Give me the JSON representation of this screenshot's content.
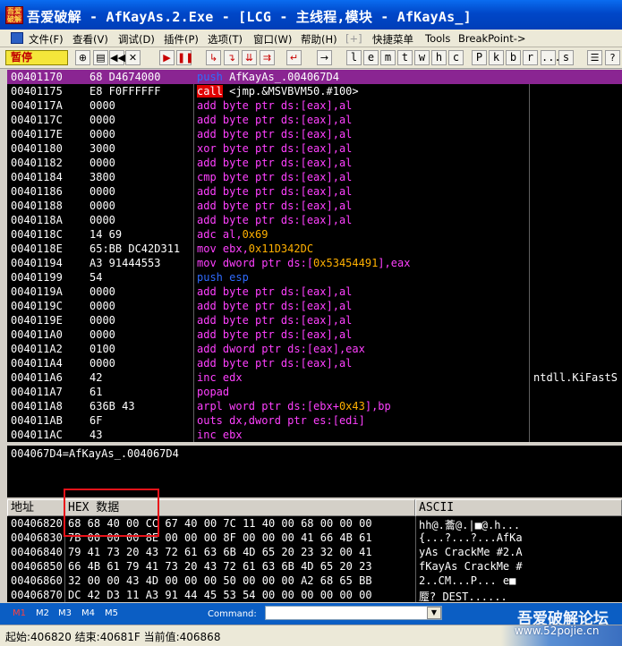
{
  "titlebar": {
    "icon_text": "吾爱\n破解",
    "title": "吾爱破解 - AfKayAs.2.Exe - [LCG - 主线程,模块 - AfKayAs_]"
  },
  "menubar": {
    "items": [
      "文件(F)",
      "查看(V)",
      "调试(D)",
      "插件(P)",
      "选项(T)",
      "窗口(W)",
      "帮助(H)",
      "[+]",
      "快捷菜单",
      "Tools",
      "BreakPoint->"
    ]
  },
  "toolbar": {
    "status": "暂停",
    "letter_buttons": [
      "l",
      "e",
      "m",
      "t",
      "w",
      "h",
      "c",
      "P",
      "k",
      "b",
      "r",
      "...",
      "s"
    ]
  },
  "disassembly": {
    "rows": [
      {
        "addr": "00401170",
        "hex": "68 D4674000",
        "ins": [
          [
            "push",
            "k-push"
          ],
          [
            " AfKayAs_.004067D4",
            "k-norm"
          ]
        ],
        "selected": true
      },
      {
        "addr": "00401175",
        "hex": "E8 F0FFFFFF",
        "ins": [
          [
            "call",
            "k-call"
          ],
          [
            " <jmp.&MSVBVM50.#100>",
            "k-norm"
          ]
        ]
      },
      {
        "addr": "0040117A",
        "hex": "0000",
        "ins": [
          [
            "add byte ptr ds:[eax],al",
            "k-op"
          ]
        ]
      },
      {
        "addr": "0040117C",
        "hex": "0000",
        "ins": [
          [
            "add byte ptr ds:[eax],al",
            "k-op"
          ]
        ]
      },
      {
        "addr": "0040117E",
        "hex": "0000",
        "ins": [
          [
            "add byte ptr ds:[eax],al",
            "k-op"
          ]
        ]
      },
      {
        "addr": "00401180",
        "hex": "3000",
        "ins": [
          [
            "xor byte ptr ds:[eax],al",
            "k-op"
          ]
        ]
      },
      {
        "addr": "00401182",
        "hex": "0000",
        "ins": [
          [
            "add byte ptr ds:[eax],al",
            "k-op"
          ]
        ]
      },
      {
        "addr": "00401184",
        "hex": "3800",
        "ins": [
          [
            "cmp byte ptr ds:[eax],al",
            "k-op"
          ]
        ]
      },
      {
        "addr": "00401186",
        "hex": "0000",
        "ins": [
          [
            "add byte ptr ds:[eax],al",
            "k-op"
          ]
        ]
      },
      {
        "addr": "00401188",
        "hex": "0000",
        "ins": [
          [
            "add byte ptr ds:[eax],al",
            "k-op"
          ]
        ]
      },
      {
        "addr": "0040118A",
        "hex": "0000",
        "ins": [
          [
            "add byte ptr ds:[eax],al",
            "k-op"
          ]
        ]
      },
      {
        "addr": "0040118C",
        "hex": "14 69",
        "ins": [
          [
            "adc al,",
            "k-op"
          ],
          [
            "0x69",
            "k-num"
          ]
        ]
      },
      {
        "addr": "0040118E",
        "hex": "65:BB DC42D311",
        "ins": [
          [
            "mov ebx,",
            "k-op"
          ],
          [
            "0x11D342DC",
            "k-num"
          ]
        ]
      },
      {
        "addr": "00401194",
        "hex": "A3 91444553",
        "ins": [
          [
            "mov dword ptr ds:[",
            "k-op"
          ],
          [
            "0x53454491",
            "k-num"
          ],
          [
            "],eax",
            "k-op"
          ]
        ]
      },
      {
        "addr": "00401199",
        "hex": "54",
        "ins": [
          [
            "push esp",
            "k-push"
          ]
        ]
      },
      {
        "addr": "0040119A",
        "hex": "0000",
        "ins": [
          [
            "add byte ptr ds:[eax],al",
            "k-op"
          ]
        ]
      },
      {
        "addr": "0040119C",
        "hex": "0000",
        "ins": [
          [
            "add byte ptr ds:[eax],al",
            "k-op"
          ]
        ]
      },
      {
        "addr": "0040119E",
        "hex": "0000",
        "ins": [
          [
            "add byte ptr ds:[eax],al",
            "k-op"
          ]
        ]
      },
      {
        "addr": "004011A0",
        "hex": "0000",
        "ins": [
          [
            "add byte ptr ds:[eax],al",
            "k-op"
          ]
        ]
      },
      {
        "addr": "004011A2",
        "hex": "0100",
        "ins": [
          [
            "add dword ptr ds:[eax],eax",
            "k-op"
          ]
        ]
      },
      {
        "addr": "004011A4",
        "hex": "0000",
        "ins": [
          [
            "add byte ptr ds:[eax],al",
            "k-op"
          ]
        ]
      },
      {
        "addr": "004011A6",
        "hex": "42",
        "ins": [
          [
            "inc edx",
            "k-op"
          ]
        ]
      },
      {
        "addr": "004011A7",
        "hex": "61",
        "ins": [
          [
            "popad",
            "k-op"
          ]
        ]
      },
      {
        "addr": "004011A8",
        "hex": "636B 43",
        "ins": [
          [
            "arpl word ptr ds:[ebx+",
            "k-op"
          ],
          [
            "0x43",
            "k-num"
          ],
          [
            "],bp",
            "k-op"
          ]
        ]
      },
      {
        "addr": "004011AB",
        "hex": "6F",
        "ins": [
          [
            "outs dx,dword ptr es:[edi]",
            "k-op"
          ]
        ]
      },
      {
        "addr": "004011AC",
        "hex": "43",
        "ins": [
          [
            "inc ebx",
            "k-op"
          ]
        ]
      }
    ],
    "comment": "ntdll.KiFastS"
  },
  "info": {
    "text": "004067D4=AfKayAs_.004067D4"
  },
  "dump": {
    "header_addr": "地址",
    "header_hex": "HEX 数据",
    "header_ascii": "ASCII",
    "rows": [
      {
        "addr": "00406820",
        "hex": "68 68 40 00 CC 67 40 00 7C 11 40 00 68 00 00 00",
        "ascii": "hh@.蘥@.|■@.h..."
      },
      {
        "addr": "00406830",
        "hex": "7B 00 00 00 8E 00 00 00 8F 00 00 00 41 66 4B 61",
        "ascii": "{...?...?...AfKa"
      },
      {
        "addr": "00406840",
        "hex": "79 41 73 20 43 72 61 63 6B 4D 65 20 23 32 00 41",
        "ascii": "yAs CrackMe #2.A"
      },
      {
        "addr": "00406850",
        "hex": "66 4B 61 79 41 73 20 43 72 61 63 6B 4D 65 20 23",
        "ascii": "fKayAs CrackMe #"
      },
      {
        "addr": "00406860",
        "hex": "32 00 00 43 4D 00 00 00 50 00 00 00 A2 68 65 BB",
        "ascii": "2..CM...P...  e■"
      },
      {
        "addr": "00406870",
        "hex": "DC 42 D3 11 A3 91 44 45 53 54 00 00 00 00 00 00",
        "ascii": "蹷?  DEST......"
      }
    ]
  },
  "bottom": {
    "tabs": [
      "M1",
      "M2",
      "M3",
      "M4",
      "M5"
    ],
    "command_label": "Command:",
    "command_value": "",
    "watermark_cn": "吾爱破解论坛",
    "watermark_url": "www.52pojie.cn"
  },
  "statusbar": {
    "text": "起始:406820 结束:40681F 当前值:406868"
  },
  "colors": {
    "selected_row": "#8a2592",
    "push": "#2f6bff",
    "call_bg": "#e00000",
    "opcode": "#ff40ff",
    "number": "#ffb000",
    "highlight_box": "#e8131a"
  }
}
